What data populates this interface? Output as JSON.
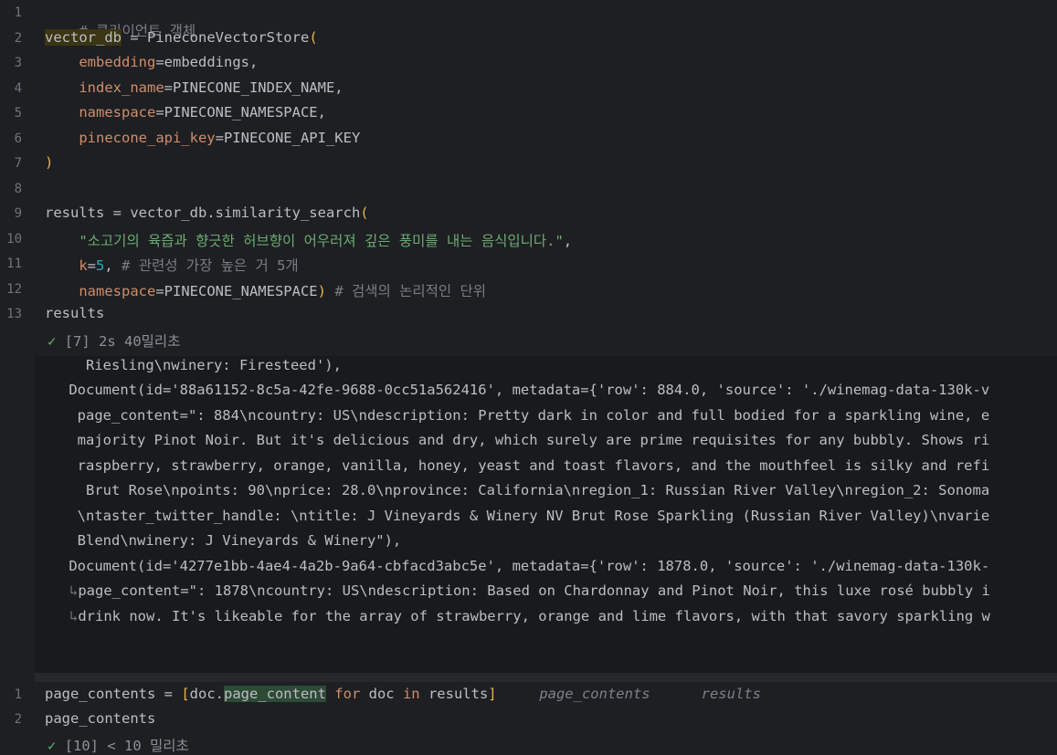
{
  "cell1": {
    "lines": [
      {
        "n": "1",
        "comment": "# 클라이언트 객체"
      },
      {
        "n": "2",
        "var": "vector_db",
        "eq": " = ",
        "call": "PineconeVectorStore",
        "open": "("
      },
      {
        "n": "3",
        "param": "embedding",
        "rest": "=embeddings,"
      },
      {
        "n": "4",
        "param": "index_name",
        "rest": "=PINECONE_INDEX_NAME,"
      },
      {
        "n": "5",
        "param": "namespace",
        "rest": "=PINECONE_NAMESPACE,"
      },
      {
        "n": "6",
        "param": "pinecone_api_key",
        "rest": "=PINECONE_API_KEY"
      },
      {
        "n": "7",
        "close": ")"
      },
      {
        "n": "8"
      },
      {
        "n": "9",
        "text": "results = vector_db.similarity_search",
        "open": "("
      },
      {
        "n": "10",
        "string": "\"소고기의 육즙과 향긋한 허브향이 어우러져 깊은 풍미를 내는 음식입니다.\"",
        "rest": ","
      },
      {
        "n": "11",
        "param": "k",
        "eq": "=",
        "num": "5",
        "rest": ", ",
        "comment": "# 관련성 가장 높은 거 5개"
      },
      {
        "n": "12",
        "param": "namespace",
        "rest": "=PINECONE_NAMESPACE",
        "close": ")",
        "comment": " # 검색의 논리적인 단위"
      },
      {
        "n": "13",
        "text": "results"
      }
    ],
    "status": {
      "check": "✓",
      "text": "[7] 2s 40밀리초"
    }
  },
  "output": {
    "lines": [
      "      Riesling\\nwinery: Firesteed'),",
      "    Document(id='88a61152-8c5a-42fe-9688-0cc51a562416', metadata={'row': 884.0, 'source': './winemag-data-130k-v",
      "     page_content=\": 884\\ncountry: US\\ndescription: Pretty dark in color and full bodied for a sparkling wine, e",
      "     majority Pinot Noir. But it's delicious and dry, which surely are prime requisites for any bubbly. Shows ri",
      "     raspberry, strawberry, orange, vanilla, honey, yeast and toast flavors, and the mouthfeel is silky and refi",
      "      Brut Rose\\npoints: 90\\nprice: 28.0\\nprovince: California\\nregion_1: Russian River Valley\\nregion_2: Sonoma",
      "     \\ntaster_twitter_handle: \\ntitle: J Vineyards & Winery NV Brut Rose Sparkling (Russian River Valley)\\nvarie",
      "     Blend\\nwinery: J Vineyards & Winery\"),",
      "    Document(id='4277e1bb-4ae4-4a2b-9a64-cbfacd3abc5e', metadata={'row': 1878.0, 'source': './winemag-data-130k-",
      "page_content=\": 1878\\ncountry: US\\ndescription: Based on Chardonnay and Pinot Noir, this luxe rosé bubbly i",
      "drink now. It's likeable for the array of strawberry, orange and lime flavors, with that savory sparkling w"
    ],
    "wrap_mark": "↳"
  },
  "cell2": {
    "lines": [
      {
        "n": "1",
        "pre": "page_contents = ",
        "lb": "[",
        "doc": "doc.",
        "attr": "page_content",
        "kw1": " for ",
        "mid": "doc",
        "kw2": " in ",
        "post": "results",
        "rb": "]",
        "hint1": "page_contents",
        "hint2": "results"
      },
      {
        "n": "2",
        "text": "page_contents"
      }
    ],
    "status": "[10] < 10 밀리초"
  }
}
